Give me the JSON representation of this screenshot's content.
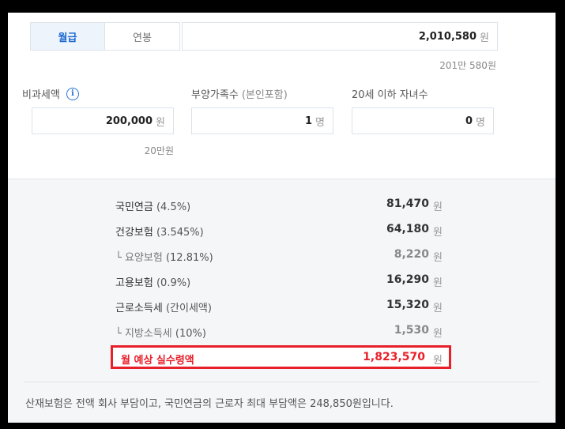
{
  "tabs": {
    "monthly": "월급",
    "annual": "연봉"
  },
  "salary": {
    "value": "2,010,580",
    "unit": "원",
    "korean": "201만 580원"
  },
  "fields": {
    "nontaxable": {
      "label": "비과세액",
      "value": "200,000",
      "unit": "원",
      "korean": "20만원"
    },
    "dependents": {
      "label": "부양가족수",
      "hint": "(본인포함)",
      "value": "1",
      "unit": "명"
    },
    "children": {
      "label": "20세 이하 자녀수",
      "value": "0",
      "unit": "명"
    }
  },
  "results": [
    {
      "name": "국민연금",
      "pct": "(4.5%)",
      "amount": "81,470",
      "unit": "원",
      "sub": false
    },
    {
      "name": "건강보험",
      "pct": "(3.545%)",
      "amount": "64,180",
      "unit": "원",
      "sub": false
    },
    {
      "name": "└ 요양보험",
      "pct": "(12.81%)",
      "amount": "8,220",
      "unit": "원",
      "sub": true
    },
    {
      "name": "고용보험",
      "pct": "(0.9%)",
      "amount": "16,290",
      "unit": "원",
      "sub": false
    },
    {
      "name": "근로소득세",
      "pct": "(간이세액)",
      "amount": "15,320",
      "unit": "원",
      "sub": false
    },
    {
      "name": "└ 지방소득세",
      "pct": "(10%)",
      "amount": "1,530",
      "unit": "원",
      "sub": true
    }
  ],
  "net": {
    "label": "월 예상 실수령액",
    "amount": "1,823,570",
    "unit": "원"
  },
  "footnote": "산재보험은 전액 회사 부담이고, 국민연금의 근로자 최대 부담액은 248,850원입니다."
}
